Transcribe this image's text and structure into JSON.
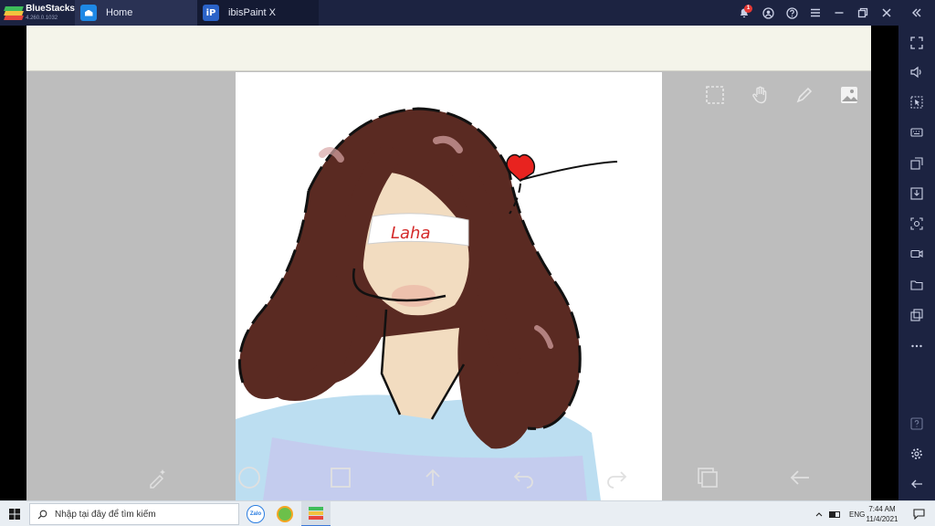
{
  "window": {
    "brand_name": "BlueStacks",
    "brand_version": "4.260.0.1032",
    "tabs": [
      {
        "label": "Home",
        "icon": "home-icon"
      },
      {
        "label": "ibisPaint X",
        "icon": "ibispaint-app-icon",
        "icon_glyph": "iP"
      }
    ],
    "notification_count": "1"
  },
  "canvas": {
    "signature_text": "Laha"
  },
  "taskbar": {
    "search_placeholder": "Nhập tại đây để tìm kiếm",
    "zalo_label": "Zalo",
    "language": "ENG",
    "time": "7:44 AM",
    "date": "11/4/2021"
  },
  "colors": {
    "titlebar": "#1c2341",
    "hair": "#5a2a22",
    "skin": "#f2dcc0",
    "shirt": "#b7dcef",
    "heart": "#e8231f",
    "canvas_bg": "#bdbdbd"
  }
}
